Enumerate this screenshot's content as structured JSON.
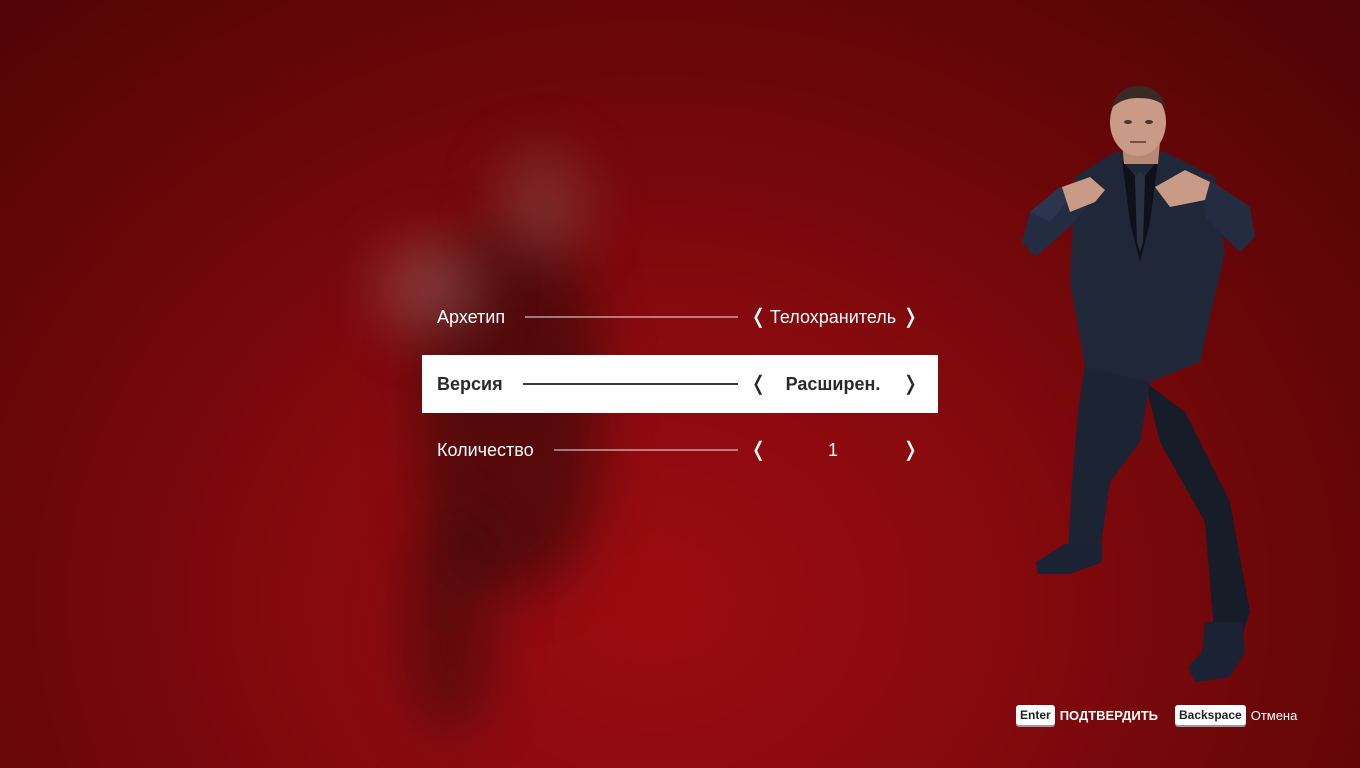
{
  "menu": {
    "rows": [
      {
        "label": "Архетип",
        "value": "Телохранитель"
      },
      {
        "label": "Версия",
        "value": "Расширен."
      },
      {
        "label": "Количество",
        "value": "1"
      }
    ],
    "selected_index": 1,
    "prev_icon": "chevron-left-icon",
    "next_icon": "chevron-right-icon"
  },
  "hints": {
    "confirm_key": "Enter",
    "confirm_label": "ПОДТВЕРДИТЬ",
    "cancel_key": "Backspace",
    "cancel_label": "Отмена"
  },
  "colors": {
    "background": "#8a0a0e",
    "selected_row": "#ffffff",
    "text": "#ffffff"
  }
}
